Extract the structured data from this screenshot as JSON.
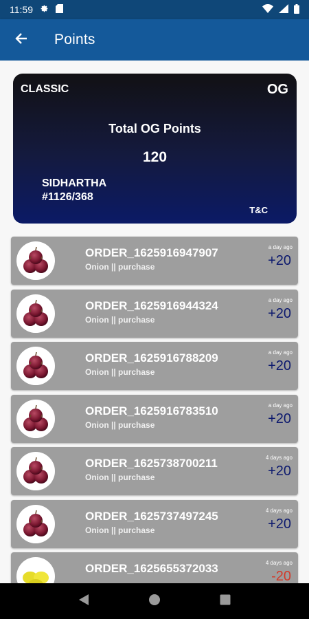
{
  "status_bar": {
    "time": "11:59",
    "icons": [
      "gear-icon",
      "sim-card-icon",
      "wifi-icon",
      "signal-icon",
      "battery-icon"
    ]
  },
  "app_bar": {
    "title": "Points",
    "back_icon": "arrow-left-icon"
  },
  "card": {
    "tier": "CLASSIC",
    "brand": "OG",
    "heading": "Total OG Points",
    "points": "120",
    "name": "SIDHARTHA",
    "member_id": "#1126/368",
    "tc_label": "T&C",
    "gradient_colors": [
      "#121114",
      "#141a3f",
      "#0b1a66"
    ]
  },
  "transactions": [
    {
      "order": "ORDER_1625916947907",
      "desc": "Onion || purchase",
      "ago": "a day ago",
      "points": "+20",
      "thumb": "onion"
    },
    {
      "order": "ORDER_1625916944324",
      "desc": "Onion || purchase",
      "ago": "a day ago",
      "points": "+20",
      "thumb": "onion"
    },
    {
      "order": "ORDER_1625916788209",
      "desc": "Onion || purchase",
      "ago": "a day ago",
      "points": "+20",
      "thumb": "onion"
    },
    {
      "order": "ORDER_1625916783510",
      "desc": "Onion || purchase",
      "ago": "a day ago",
      "points": "+20",
      "thumb": "onion"
    },
    {
      "order": "ORDER_1625738700211",
      "desc": "Onion || purchase",
      "ago": "4 days ago",
      "points": "+20",
      "thumb": "onion"
    },
    {
      "order": "ORDER_1625737497245",
      "desc": "Onion || purchase",
      "ago": "4 days ago",
      "points": "+20",
      "thumb": "onion"
    },
    {
      "order": "ORDER_1625655372033",
      "desc": "",
      "ago": "4 days ago",
      "points": "-20",
      "thumb": "lemon"
    }
  ],
  "colors": {
    "status_bar": "#0f4778",
    "app_bar": "#14599a",
    "row_bg": "#9e9e9e",
    "positive_points": "#0d1a6e",
    "negative_points": "#d23a2a"
  },
  "nav_bar": {
    "icons": [
      "back-triangle-icon",
      "home-circle-icon",
      "recents-square-icon"
    ]
  }
}
